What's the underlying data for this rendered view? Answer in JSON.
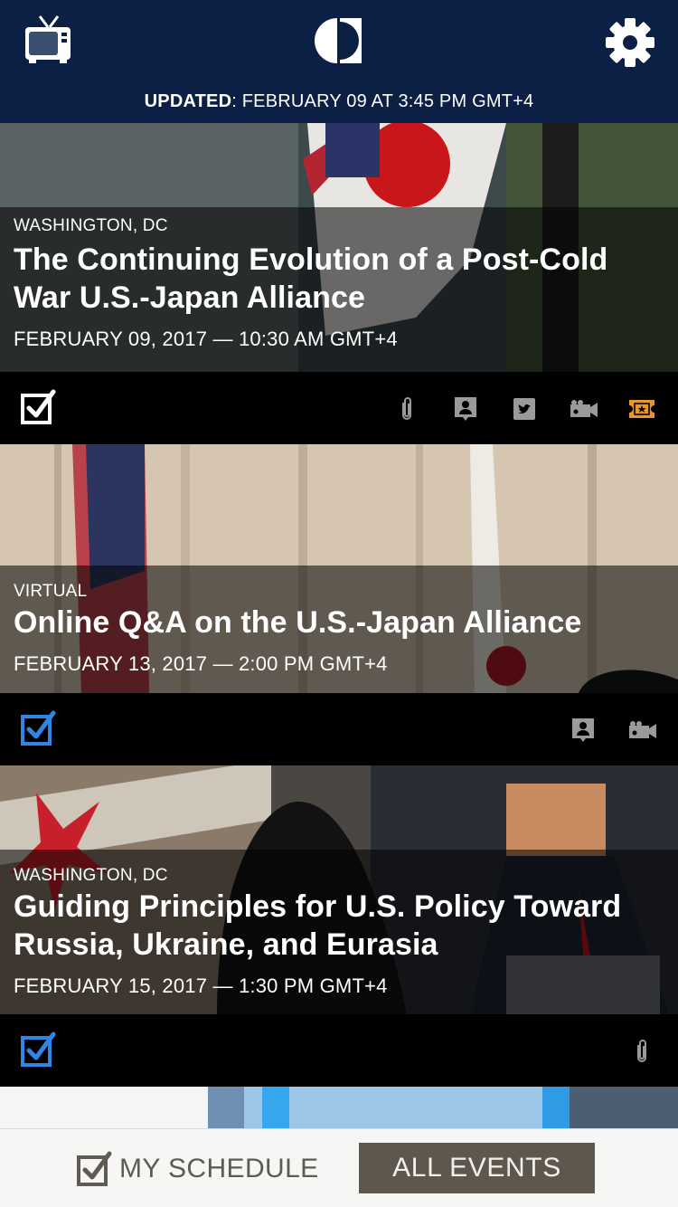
{
  "header": {
    "updated_label": "UPDATED",
    "updated_value": ": FEBRUARY 09 AT 3:45 PM GMT+4",
    "background": "#0c1f44"
  },
  "icons": {
    "tv": "tv-icon",
    "logo": "brand-logo",
    "settings": "gear-icon",
    "checkbox": "checkbox-icon",
    "attachment": "paperclip-icon",
    "speaker": "speaker-badge-icon",
    "twitter": "twitter-icon",
    "video": "video-camera-icon",
    "ticket": "ticket-icon"
  },
  "events": [
    {
      "location": "WASHINGTON, DC",
      "title": "The Continuing Evolution of a Post-Cold War U.S.-Japan Alliance",
      "date": "FEBRUARY 09, 2017 — 10:30 AM GMT+4",
      "checked_color": "#ffffff",
      "actions": [
        "attachment",
        "speaker",
        "twitter",
        "video",
        "ticket"
      ]
    },
    {
      "location": "VIRTUAL",
      "title": "Online Q&A on the U.S.-Japan Alliance",
      "date": "FEBRUARY 13, 2017 —  2:00 PM GMT+4",
      "checked_color": "#2f86e6",
      "actions": [
        "speaker",
        "video"
      ]
    },
    {
      "location": "WASHINGTON, DC",
      "title": "Guiding Principles for U.S. Policy Toward Russia, Ukraine, and Eurasia",
      "date": "FEBRUARY 15, 2017 — 1:30 PM GMT+4",
      "checked_color": "#2f86e6",
      "actions": [
        "attachment"
      ]
    }
  ],
  "tabs": {
    "my_schedule": "MY SCHEDULE",
    "all_events": "ALL EVENTS"
  },
  "colors": {
    "accent_blue": "#2f86e6",
    "ticket_orange": "#e8952a",
    "tab_active_bg": "#5e574d"
  }
}
